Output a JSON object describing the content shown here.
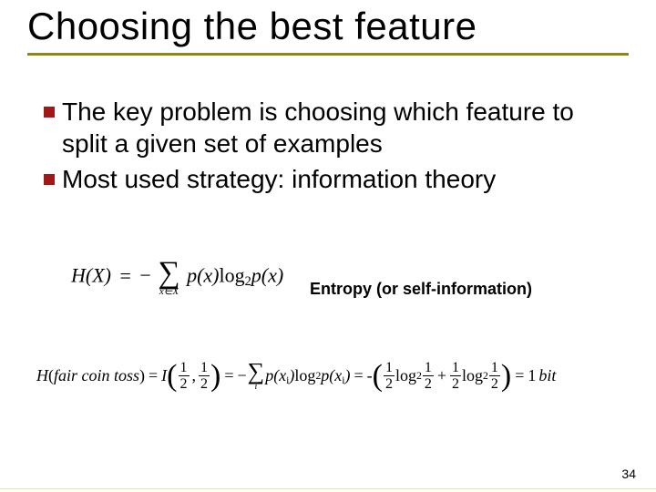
{
  "title": "Choosing the best feature",
  "bullets": [
    "The key problem is choosing which feature to split a given set of examples",
    "Most used strategy: information theory"
  ],
  "entropy_caption": "Entropy (or self-information)",
  "formula_entropy": {
    "lhs": "H(X)",
    "eq": "=",
    "neg": "−",
    "sum_over": "x∈X",
    "term_p": "p(x)",
    "log_base": "2",
    "term_p2": "p(x)"
  },
  "formula_coin": {
    "lhs_H": "H",
    "lhs_arg_label": "fair coin toss",
    "eq": "=",
    "I_label": "I",
    "half_num": "1",
    "half_den": "2",
    "neg": "−",
    "sum_over": "i",
    "p_xi": "p(x",
    "log_base": "2",
    "result_value": "1",
    "result_unit": "bit"
  },
  "page_number": "34"
}
